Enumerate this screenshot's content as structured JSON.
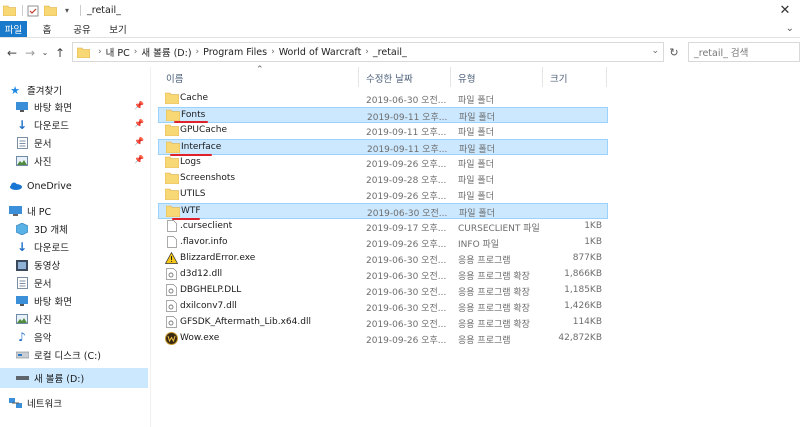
{
  "window": {
    "title": "_retail_",
    "close": "✕"
  },
  "ribbon": {
    "tabs": [
      "파일",
      "홈",
      "공유",
      "보기"
    ],
    "toggle": "⌄"
  },
  "nav": {
    "breadcrumb": [
      "내 PC",
      "새 볼륨 (D:)",
      "Program Files",
      "World of Warcraft",
      "_retail_"
    ],
    "search_placeholder": "_retail_ 검색"
  },
  "sidebar": {
    "items": [
      {
        "label": "즐겨찾기",
        "icon": "star-icon"
      },
      {
        "label": "바탕 화면",
        "icon": "desktop-icon",
        "pinned": true
      },
      {
        "label": "다운로드",
        "icon": "download-icon",
        "pinned": true
      },
      {
        "label": "문서",
        "icon": "document-icon",
        "pinned": true
      },
      {
        "label": "사진",
        "icon": "pictures-icon",
        "pinned": true
      },
      {
        "label": "OneDrive",
        "icon": "onedrive-icon"
      },
      {
        "label": "내 PC",
        "icon": "pc-icon"
      },
      {
        "label": "3D 개체",
        "icon": "3d-objects-icon"
      },
      {
        "label": "다운로드",
        "icon": "download-icon"
      },
      {
        "label": "동영상",
        "icon": "video-icon"
      },
      {
        "label": "문서",
        "icon": "document-icon"
      },
      {
        "label": "바탕 화면",
        "icon": "desktop-icon"
      },
      {
        "label": "사진",
        "icon": "pictures-icon"
      },
      {
        "label": "음악",
        "icon": "music-icon"
      },
      {
        "label": "로컬 디스크 (C:)",
        "icon": "drive-icon"
      },
      {
        "label": "새 볼륨 (D:)",
        "icon": "drive-icon",
        "selected": true
      },
      {
        "label": "네트워크",
        "icon": "network-icon"
      }
    ]
  },
  "columns": {
    "name": "이름",
    "date": "수정한 날짜",
    "type": "유형",
    "size": "크기"
  },
  "files": [
    {
      "name": "Cache",
      "date": "2019-06-30 오전...",
      "type": "파일 폴더",
      "size": "",
      "icon": "folder-icon"
    },
    {
      "name": "Fonts",
      "date": "2019-09-11 오후...",
      "type": "파일 폴더",
      "size": "",
      "icon": "folder-icon",
      "selected": true
    },
    {
      "name": "GPUCache",
      "date": "2019-09-11 오후...",
      "type": "파일 폴더",
      "size": "",
      "icon": "folder-icon"
    },
    {
      "name": "Interface",
      "date": "2019-09-11 오후...",
      "type": "파일 폴더",
      "size": "",
      "icon": "folder-icon",
      "selected": true
    },
    {
      "name": "Logs",
      "date": "2019-09-26 오후...",
      "type": "파일 폴더",
      "size": "",
      "icon": "folder-icon"
    },
    {
      "name": "Screenshots",
      "date": "2019-09-28 오후...",
      "type": "파일 폴더",
      "size": "",
      "icon": "folder-icon"
    },
    {
      "name": "UTILS",
      "date": "2019-09-26 오후...",
      "type": "파일 폴더",
      "size": "",
      "icon": "folder-icon"
    },
    {
      "name": "WTF",
      "date": "2019-06-30 오전...",
      "type": "파일 폴더",
      "size": "",
      "icon": "folder-icon",
      "selected": true
    },
    {
      "name": ".curseclient",
      "date": "2019-09-17 오후...",
      "type": "CURSECLIENT 파일",
      "size": "1KB",
      "icon": "file-icon"
    },
    {
      "name": ".flavor.info",
      "date": "2019-09-26 오후...",
      "type": "INFO 파일",
      "size": "1KB",
      "icon": "file-icon"
    },
    {
      "name": "BlizzardError.exe",
      "date": "2019-06-30 오전...",
      "type": "응용 프로그램",
      "size": "877KB",
      "icon": "warning-exe-icon"
    },
    {
      "name": "d3d12.dll",
      "date": "2019-06-30 오전...",
      "type": "응용 프로그램 확장",
      "size": "1,866KB",
      "icon": "dll-icon"
    },
    {
      "name": "DBGHELP.DLL",
      "date": "2019-06-30 오전...",
      "type": "응용 프로그램 확장",
      "size": "1,185KB",
      "icon": "dll-icon"
    },
    {
      "name": "dxilconv7.dll",
      "date": "2019-06-30 오전...",
      "type": "응용 프로그램 확장",
      "size": "1,426KB",
      "icon": "dll-icon"
    },
    {
      "name": "GFSDK_Aftermath_Lib.x64.dll",
      "date": "2019-06-30 오전...",
      "type": "응용 프로그램 확장",
      "size": "114KB",
      "icon": "dll-icon"
    },
    {
      "name": "Wow.exe",
      "date": "2019-09-26 오후...",
      "type": "응용 프로그램",
      "size": "42,872KB",
      "icon": "wow-exe-icon"
    }
  ],
  "colors": {
    "selection": "#cce8ff",
    "accent": "#1979ca",
    "folder": "#f8d775",
    "annotation": "#e0202a"
  }
}
